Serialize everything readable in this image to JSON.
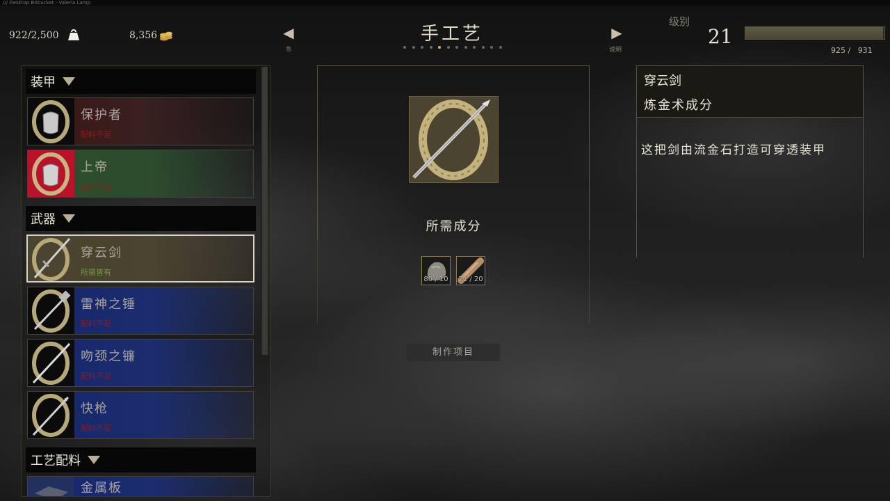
{
  "window": {
    "title": "/// Desktop Bitbucket - Valeria Lamp"
  },
  "topbar": {
    "weight": "922/2,500",
    "gold": "8,356",
    "title": "手工艺",
    "left_nav_label": "书",
    "right_nav_label": "说明",
    "page_dots": 12,
    "active_page_index": 4,
    "level_label": "级别",
    "level": "21",
    "xp_current": "925",
    "xp_max": "931",
    "xp_text": "925 /   931",
    "xp_fraction": 0.99
  },
  "categories": [
    {
      "label": "装甲",
      "items": [
        {
          "name": "保护者",
          "status": "配料不足",
          "ok": false,
          "color": "red"
        },
        {
          "name": "上帝",
          "status": "配料不足",
          "ok": false,
          "color": "green"
        }
      ]
    },
    {
      "label": "武器",
      "items": [
        {
          "name": "穿云剑",
          "status": "所需皆有",
          "ok": true,
          "color": "olive",
          "selected": true
        },
        {
          "name": "雷神之锤",
          "status": "配料不足",
          "ok": false,
          "color": "blue"
        },
        {
          "name": "吻颈之镰",
          "status": "配料不足",
          "ok": false,
          "color": "blue"
        },
        {
          "name": "快枪",
          "status": "配料不足",
          "ok": false,
          "color": "blue"
        }
      ]
    },
    {
      "label": "工艺配料",
      "items": [
        {
          "name": "金属板",
          "status": "",
          "ok": false,
          "color": "blue"
        }
      ]
    }
  ],
  "center": {
    "required_title": "所需成分",
    "ingredients": [
      {
        "count": "80 / 10",
        "icon": "stone-icon"
      },
      {
        "count": "21 / 20",
        "icon": "wood-log-icon"
      }
    ],
    "craft_button": "制作项目"
  },
  "detail": {
    "name": "穿云剑",
    "type": "炼金术成分",
    "description": "这把剑由流金石打造可穿透装甲"
  },
  "colors": {
    "accent_gold": "#d1b46a",
    "status_bad": "#8c1e1e",
    "status_ok": "#6e9d3c"
  }
}
